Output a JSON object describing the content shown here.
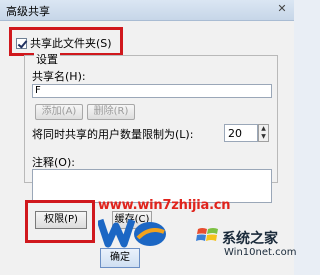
{
  "window": {
    "title": "高级共享",
    "close_glyph": "✕"
  },
  "share": {
    "checkbox_label": "共享此文件夹(S)",
    "checked": true
  },
  "settings": {
    "group_label": "设置",
    "share_name_label": "共享名(H):",
    "share_name_value": "F",
    "add_label": "添加(A)",
    "delete_label": "删除(R)",
    "limit_label": "将同时共享的用户数量限制为(L):",
    "limit_value": "20",
    "spin_up_glyph": "▲",
    "spin_down_glyph": "▼",
    "comment_label": "注释(O):"
  },
  "buttons": {
    "permissions_label": "权限(P)",
    "caching_label": "缓存(C)",
    "ok_label": "确定"
  },
  "watermark": {
    "url": "www.win7zhijia.cn",
    "brand": "系统之家",
    "site": "Win10net.com"
  },
  "colors": {
    "highlight_red": "#d0181d",
    "watermark_red": "#e0231c",
    "logo_blue": "#1c67c4",
    "logo_orange": "#f2a21c"
  }
}
